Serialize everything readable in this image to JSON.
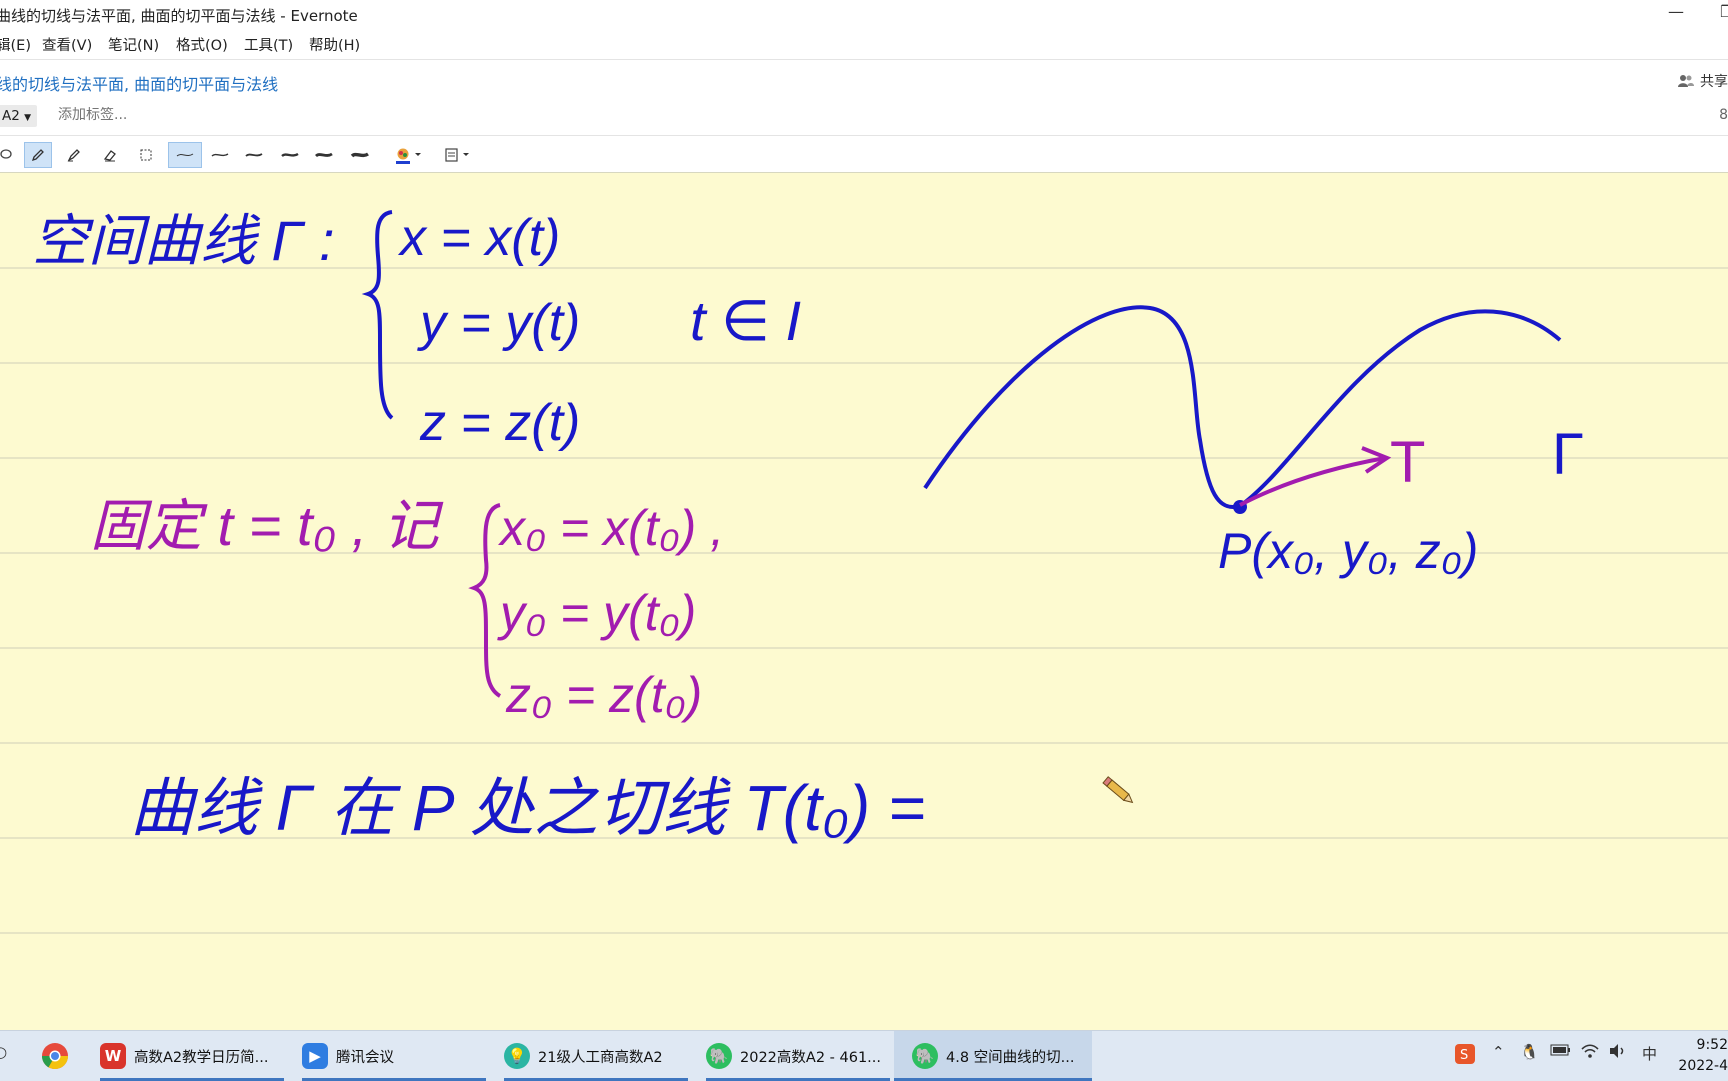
{
  "window": {
    "title": "曲线的切线与法平面, 曲面的切平面与法线 - Evernote",
    "minimize_glyph": "—",
    "maximize_glyph": "❐"
  },
  "menu": [
    {
      "label": "辑(E)"
    },
    {
      "label": "查看(V)"
    },
    {
      "label": "笔记(N)"
    },
    {
      "label": "格式(O)"
    },
    {
      "label": "工具(T)"
    },
    {
      "label": "帮助(H)"
    }
  ],
  "note": {
    "title": "线的切线与法平面, 曲面的切平面与法线",
    "share_label": "共享",
    "notebook": "A2",
    "tag_placeholder": "添加标签...",
    "right_number": "8"
  },
  "ink_toolbar": {
    "tools": [
      "lasso-icon",
      "pen-icon",
      "highlighter-icon",
      "eraser-icon",
      "select-rect-icon"
    ],
    "active_tool": "pen-icon",
    "stroke_widths": 6,
    "active_width": 1,
    "color_accent": "#1f3fd0"
  },
  "handwriting": {
    "ink_blue": "#1818c8",
    "ink_purple": "#a21caf",
    "line1_label": "空间曲线 Γ :",
    "eq_x": "x = x(t)",
    "eq_y": "y = y(t)",
    "domain": "t ∈ I",
    "eq_z": "z = z(t)",
    "fix_text": "固定 t = t₀ , 记",
    "eq_x0": "x₀ = x(t₀) ,",
    "eq_y0": "y₀ = y(t₀)",
    "eq_z0": "z₀ = z(t₀)",
    "tangent_label": "T",
    "curve_label": "Γ",
    "point_label": "P(x₀, y₀, z₀)",
    "bottom_line": "曲线 Γ 在 P 处之切线   T(t₀) ="
  },
  "taskbar": {
    "items": [
      {
        "label": "高数A2教学日历简...",
        "icon_text": "W",
        "color": "#d9342b"
      },
      {
        "label": "腾讯会议",
        "icon_text": "▶",
        "color": "#2f7de1"
      },
      {
        "label": "21级人工商高数A2",
        "icon_text": "💡",
        "color": "#2bb5a3"
      },
      {
        "label": "2022高数A2 - 461...",
        "icon_text": "🐘",
        "color": "#2dbe60"
      },
      {
        "label": "4.8 空间曲线的切...",
        "icon_text": "🐘",
        "color": "#2dbe60"
      }
    ],
    "ime": "中",
    "time": "9:52",
    "date": "2022-4"
  }
}
